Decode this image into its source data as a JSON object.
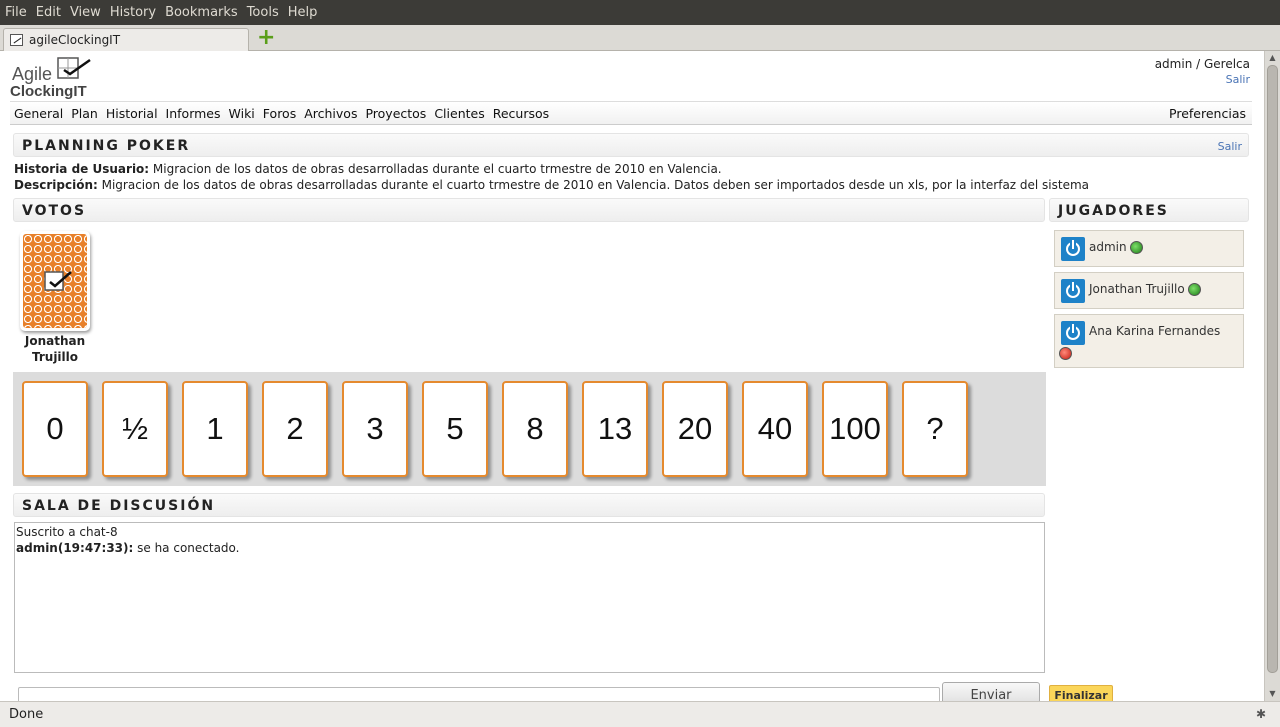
{
  "browser": {
    "menu": [
      "File",
      "Edit",
      "View",
      "History",
      "Bookmarks",
      "Tools",
      "Help"
    ],
    "tab_title": "agileClockingIT",
    "status": "Done"
  },
  "logo": {
    "line1": "Agile",
    "line2": "ClockingIT"
  },
  "user": {
    "name": "admin / Gerelca",
    "logout": "Salir"
  },
  "nav": {
    "items": [
      "General",
      "Plan",
      "Historial",
      "Informes",
      "Wiki",
      "Foros",
      "Archivos",
      "Proyectos",
      "Clientes",
      "Recursos"
    ],
    "preferences": "Preferencias"
  },
  "planning": {
    "title": "PLANNING POKER",
    "exit": "Salir",
    "story_label": "Historia de Usuario:",
    "story_text": " Migracion de los datos de obras desarrolladas durante el cuarto trmestre de 2010 en Valencia.",
    "desc_label": "Descripción:",
    "desc_text": " Migracion de los datos de obras desarrolladas durante el cuarto trmestre de 2010 en Valencia. Datos deben ser importados desde un xls, por la interfaz del sistema"
  },
  "votes": {
    "title": "VOTOS",
    "cards": [
      {
        "player_line1": "Jonathan",
        "player_line2": "Trujillo"
      }
    ]
  },
  "deck": [
    "0",
    "½",
    "1",
    "2",
    "3",
    "5",
    "8",
    "13",
    "20",
    "40",
    "100",
    "?"
  ],
  "players": {
    "title": "JUGADORES",
    "list": [
      {
        "name": "admin",
        "status": "online",
        "color": "#2a9a1e"
      },
      {
        "name": "Jonathan Trujillo",
        "status": "online",
        "color": "#2a9a1e"
      },
      {
        "name": "Ana Karina Fernandes",
        "status": "offline",
        "color": "#d4231a"
      }
    ]
  },
  "chat": {
    "title": "SALA DE DISCUSIÓN",
    "line1": "Suscrito a chat-8",
    "msg_user": "admin(19:47:33):",
    "msg_text": " se ha conectado.",
    "send": "Enviar",
    "finish": "Finalizar"
  },
  "colors": {
    "accent": "#e58a2e",
    "link": "#4a74b5",
    "power": "#1e82c8"
  }
}
